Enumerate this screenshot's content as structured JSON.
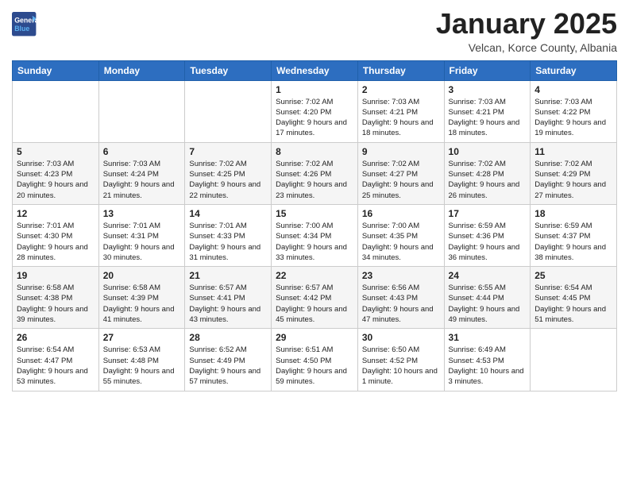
{
  "header": {
    "logo_line1": "General",
    "logo_line2": "Blue",
    "month_title": "January 2025",
    "subtitle": "Velcan, Korce County, Albania"
  },
  "days_of_week": [
    "Sunday",
    "Monday",
    "Tuesday",
    "Wednesday",
    "Thursday",
    "Friday",
    "Saturday"
  ],
  "weeks": [
    [
      {
        "num": "",
        "info": ""
      },
      {
        "num": "",
        "info": ""
      },
      {
        "num": "",
        "info": ""
      },
      {
        "num": "1",
        "info": "Sunrise: 7:02 AM\nSunset: 4:20 PM\nDaylight: 9 hours and 17 minutes."
      },
      {
        "num": "2",
        "info": "Sunrise: 7:03 AM\nSunset: 4:21 PM\nDaylight: 9 hours and 18 minutes."
      },
      {
        "num": "3",
        "info": "Sunrise: 7:03 AM\nSunset: 4:21 PM\nDaylight: 9 hours and 18 minutes."
      },
      {
        "num": "4",
        "info": "Sunrise: 7:03 AM\nSunset: 4:22 PM\nDaylight: 9 hours and 19 minutes."
      }
    ],
    [
      {
        "num": "5",
        "info": "Sunrise: 7:03 AM\nSunset: 4:23 PM\nDaylight: 9 hours and 20 minutes."
      },
      {
        "num": "6",
        "info": "Sunrise: 7:03 AM\nSunset: 4:24 PM\nDaylight: 9 hours and 21 minutes."
      },
      {
        "num": "7",
        "info": "Sunrise: 7:02 AM\nSunset: 4:25 PM\nDaylight: 9 hours and 22 minutes."
      },
      {
        "num": "8",
        "info": "Sunrise: 7:02 AM\nSunset: 4:26 PM\nDaylight: 9 hours and 23 minutes."
      },
      {
        "num": "9",
        "info": "Sunrise: 7:02 AM\nSunset: 4:27 PM\nDaylight: 9 hours and 25 minutes."
      },
      {
        "num": "10",
        "info": "Sunrise: 7:02 AM\nSunset: 4:28 PM\nDaylight: 9 hours and 26 minutes."
      },
      {
        "num": "11",
        "info": "Sunrise: 7:02 AM\nSunset: 4:29 PM\nDaylight: 9 hours and 27 minutes."
      }
    ],
    [
      {
        "num": "12",
        "info": "Sunrise: 7:01 AM\nSunset: 4:30 PM\nDaylight: 9 hours and 28 minutes."
      },
      {
        "num": "13",
        "info": "Sunrise: 7:01 AM\nSunset: 4:31 PM\nDaylight: 9 hours and 30 minutes."
      },
      {
        "num": "14",
        "info": "Sunrise: 7:01 AM\nSunset: 4:33 PM\nDaylight: 9 hours and 31 minutes."
      },
      {
        "num": "15",
        "info": "Sunrise: 7:00 AM\nSunset: 4:34 PM\nDaylight: 9 hours and 33 minutes."
      },
      {
        "num": "16",
        "info": "Sunrise: 7:00 AM\nSunset: 4:35 PM\nDaylight: 9 hours and 34 minutes."
      },
      {
        "num": "17",
        "info": "Sunrise: 6:59 AM\nSunset: 4:36 PM\nDaylight: 9 hours and 36 minutes."
      },
      {
        "num": "18",
        "info": "Sunrise: 6:59 AM\nSunset: 4:37 PM\nDaylight: 9 hours and 38 minutes."
      }
    ],
    [
      {
        "num": "19",
        "info": "Sunrise: 6:58 AM\nSunset: 4:38 PM\nDaylight: 9 hours and 39 minutes."
      },
      {
        "num": "20",
        "info": "Sunrise: 6:58 AM\nSunset: 4:39 PM\nDaylight: 9 hours and 41 minutes."
      },
      {
        "num": "21",
        "info": "Sunrise: 6:57 AM\nSunset: 4:41 PM\nDaylight: 9 hours and 43 minutes."
      },
      {
        "num": "22",
        "info": "Sunrise: 6:57 AM\nSunset: 4:42 PM\nDaylight: 9 hours and 45 minutes."
      },
      {
        "num": "23",
        "info": "Sunrise: 6:56 AM\nSunset: 4:43 PM\nDaylight: 9 hours and 47 minutes."
      },
      {
        "num": "24",
        "info": "Sunrise: 6:55 AM\nSunset: 4:44 PM\nDaylight: 9 hours and 49 minutes."
      },
      {
        "num": "25",
        "info": "Sunrise: 6:54 AM\nSunset: 4:45 PM\nDaylight: 9 hours and 51 minutes."
      }
    ],
    [
      {
        "num": "26",
        "info": "Sunrise: 6:54 AM\nSunset: 4:47 PM\nDaylight: 9 hours and 53 minutes."
      },
      {
        "num": "27",
        "info": "Sunrise: 6:53 AM\nSunset: 4:48 PM\nDaylight: 9 hours and 55 minutes."
      },
      {
        "num": "28",
        "info": "Sunrise: 6:52 AM\nSunset: 4:49 PM\nDaylight: 9 hours and 57 minutes."
      },
      {
        "num": "29",
        "info": "Sunrise: 6:51 AM\nSunset: 4:50 PM\nDaylight: 9 hours and 59 minutes."
      },
      {
        "num": "30",
        "info": "Sunrise: 6:50 AM\nSunset: 4:52 PM\nDaylight: 10 hours and 1 minute."
      },
      {
        "num": "31",
        "info": "Sunrise: 6:49 AM\nSunset: 4:53 PM\nDaylight: 10 hours and 3 minutes."
      },
      {
        "num": "",
        "info": ""
      }
    ]
  ]
}
